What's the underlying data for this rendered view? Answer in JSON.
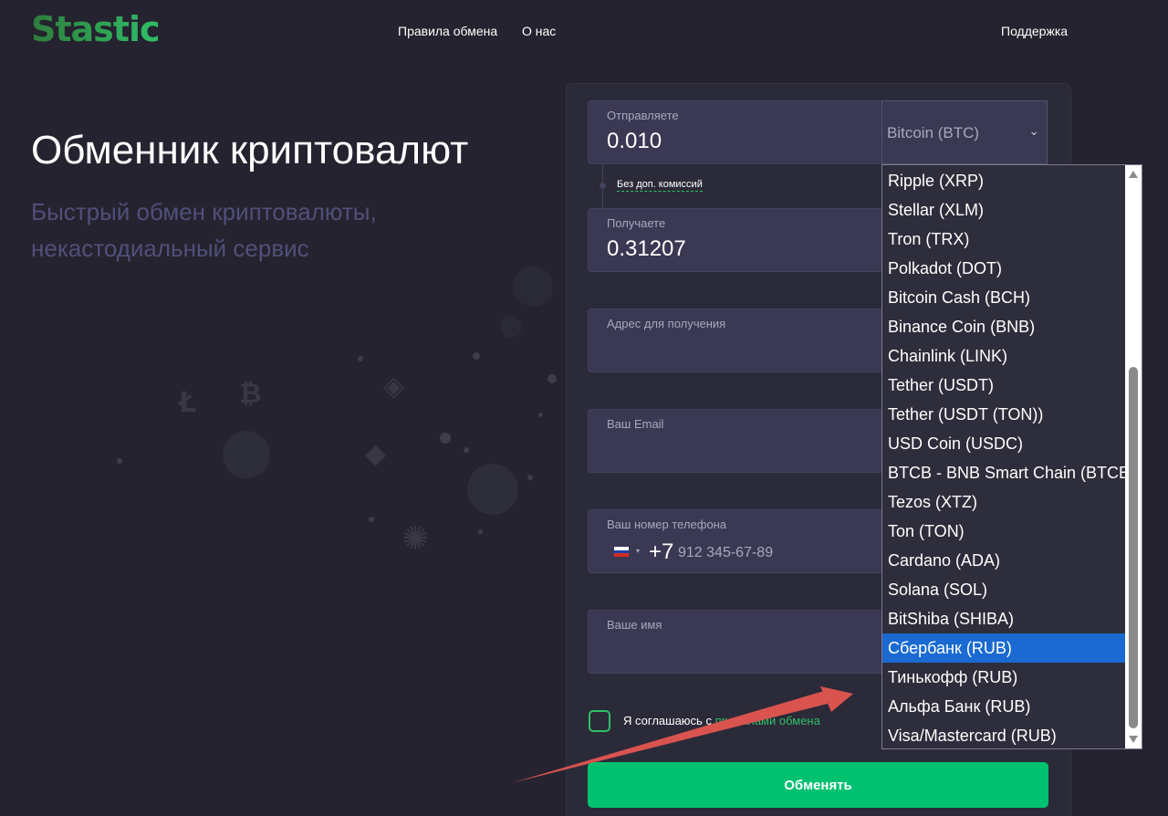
{
  "header": {
    "logo": "Stastic",
    "nav": [
      "Правила обмена",
      "О нас"
    ],
    "support": "Поддержка"
  },
  "hero": {
    "title": "Обменник криптовалют",
    "subtitle": "Быстрый обмен криптовалюты, некастодиальный сервис"
  },
  "form": {
    "send": {
      "label": "Отправляете",
      "value": "0.010",
      "currency": "Bitcoin (BTC)"
    },
    "fee_note": "Без доп. комиссий",
    "receive": {
      "label": "Получаете",
      "value": "0.31207"
    },
    "address": {
      "label": "Адрес для получения"
    },
    "email": {
      "label": "Ваш Email"
    },
    "phone": {
      "label": "Ваш номер телефона",
      "code": "+7",
      "placeholder": "912 345-67-89"
    },
    "name": {
      "label": "Ваше имя"
    },
    "agree_text": "Я соглашаюсь с",
    "agree_link": "правилами обмена",
    "submit": "Обменять"
  },
  "dropdown": {
    "options": [
      "Ripple (XRP)",
      "Stellar (XLM)",
      "Tron (TRX)",
      "Polkadot (DOT)",
      "Bitcoin Cash (BCH)",
      "Binance Coin (BNB)",
      "Chainlink (LINK)",
      "Tether (USDT)",
      "Tether (USDT (TON))",
      "USD Coin (USDC)",
      "BTCB - BNB Smart Chain (BTCB)",
      "Tezos (XTZ)",
      "Ton (TON)",
      "Cardano (ADA)",
      "Solana (SOL)",
      "BitShiba (SHIBA)",
      "Сбербанк (RUB)",
      "Тинькофф (RUB)",
      "Альфа Банк (RUB)",
      "Visa/Mastercard (RUB)"
    ],
    "selected_index": 16
  },
  "colors": {
    "accent": "#00c170",
    "background": "#24232f",
    "selected": "#1a6ad1",
    "annotation_arrow": "#d9534f"
  }
}
